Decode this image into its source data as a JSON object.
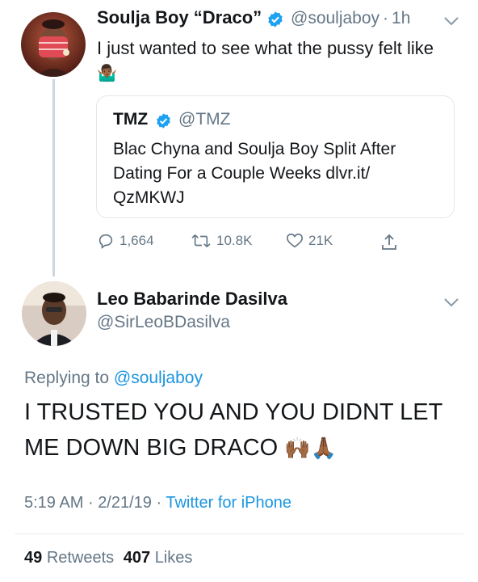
{
  "tweet1": {
    "display_name": "Soulja Boy “Draco”",
    "handle": "@souljaboy",
    "separator": "·",
    "time": "1h",
    "text": "I just wanted to see what the pussy felt like",
    "emoji": "🤷🏾‍♂️",
    "quote": {
      "display_name": "TMZ",
      "handle": "@TMZ",
      "text_lines": [
        "Blac Chyna and Soulja Boy Split After",
        "Dating For a Couple Weeks dlvr.it/",
        "QzMKWJ"
      ]
    },
    "actions": {
      "replies": "1,664",
      "retweets": "10.8K",
      "likes": "21K"
    }
  },
  "tweet2": {
    "display_name": "Leo Babarinde Dasilva",
    "handle": "@SirLeoBDasilva",
    "replying_label": "Replying to",
    "replying_handle": "@souljaboy",
    "text_lines": [
      "I TRUSTED YOU AND YOU DIDNT LET",
      "ME DOWN BIG DRACO"
    ],
    "emoji": "🙌🏾🙏🏾",
    "time": "5:19 AM",
    "sep1": "·",
    "date": "2/21/19",
    "sep2": "·",
    "client": "Twitter for iPhone",
    "retweets_count": "49",
    "retweets_label": "Retweets",
    "likes_count": "407",
    "likes_label": "Likes"
  },
  "colors": {
    "verified": "#1da1f2",
    "link": "#1b95e0",
    "muted": "#657786",
    "text": "#14171a"
  },
  "icons": [
    "verified-badge-icon",
    "chevron-down-icon",
    "reply-icon",
    "retweet-icon",
    "like-icon",
    "share-icon"
  ]
}
